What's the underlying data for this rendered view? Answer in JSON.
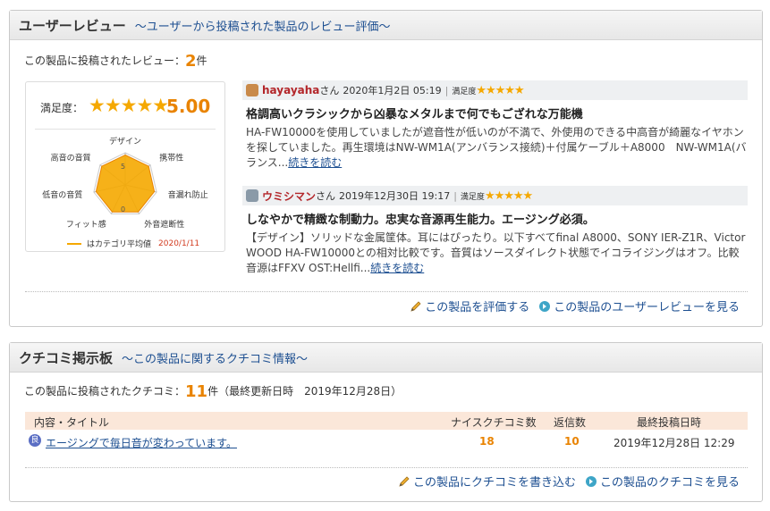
{
  "review_panel": {
    "title": "ユーザーレビュー",
    "subtitle": "〜ユーザーから投稿された製品のレビュー評価〜",
    "count_prefix": "この製品に投稿されたレビュー：",
    "count": "2",
    "count_suffix": "件",
    "summary": {
      "label": "満足度：",
      "stars": "★★★★★",
      "score": "5.00",
      "radar_axes": [
        "デザイン",
        "携帯性",
        "音漏れ防止",
        "外音遮断性",
        "フィット感",
        "低音の音質",
        "高音の音質"
      ],
      "radar_scale_max": "5",
      "radar_scale_min": "0",
      "legend_label": "はカテゴリ平均値",
      "legend_date": "2020/1/11",
      "accent_color": "#f5a800"
    },
    "reviews": [
      {
        "user": "hayayaha",
        "honorific": "さん",
        "date": "2020年1月2日 05:19",
        "rating_label": "満足度",
        "stars": "★★★★★",
        "title": "格調高いクラシックから凶暴なメタルまで何でもござれな万能機",
        "body": "HA-FW10000を使用していましたが遮音性が低いのが不満で、外使用のできる中高音が綺麗なイヤホンを探していました。再生環境はNW-WM1A(アンバランス接続)＋付属ケーブル＋A8000　NW-WM1A(バランス...",
        "read_more": "続きを読む"
      },
      {
        "user": "ウミシマン",
        "honorific": "さん",
        "date": "2019年12月30日 19:17",
        "rating_label": "満足度",
        "stars": "★★★★★",
        "title": "しなやかで精緻な制動力。忠実な音源再生能力。エージング必須。",
        "body": "【デザイン】ソリッドな金属筐体。耳にはぴったり。以下すべてfinal A8000、SONY IER-Z1R、Victor WOOD HA-FW10000との相対比較です。音質はソースダイレクト状態でイコライジングはオフ。比較音源はFFXV OST:Hellfi...",
        "read_more": "続きを読む"
      }
    ],
    "actions": {
      "rate": "この製品を評価する",
      "view_reviews": "この製品のユーザーレビューを見る"
    }
  },
  "kuchikomi_panel": {
    "title": "クチコミ掲示板",
    "subtitle": "〜この製品に関するクチコミ情報〜",
    "count_prefix": "この製品に投稿されたクチコミ：",
    "count": "11",
    "count_suffix": "件（最終更新日時　2019年12月28日）",
    "columns": {
      "title": "内容・タイトル",
      "nice": "ナイスクチコミ数",
      "replies": "返信数",
      "last_post": "最終投稿日時"
    },
    "rows": [
      {
        "badge": "良",
        "title": "エージングで毎日音が変わっています。",
        "nice": "18",
        "replies": "10",
        "last_post": "2019年12月28日 12:29"
      }
    ],
    "actions": {
      "write": "この製品にクチコミを書き込む",
      "view": "この製品のクチコミを見る"
    }
  }
}
